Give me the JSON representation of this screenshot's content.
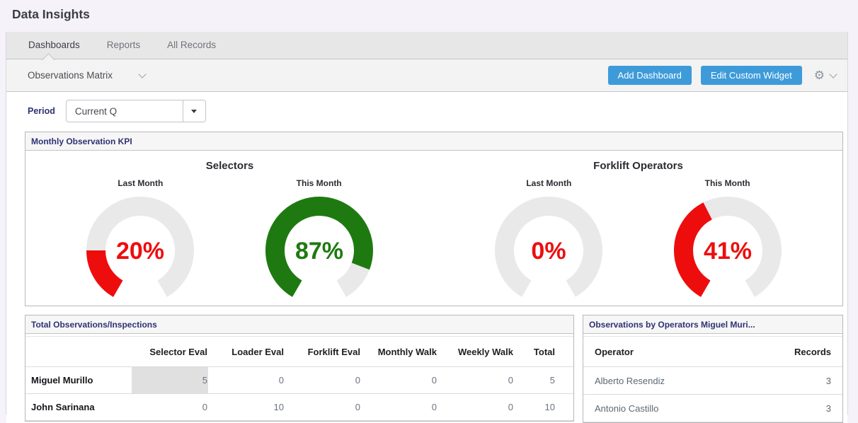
{
  "page": {
    "title": "Data Insights"
  },
  "tabs": [
    {
      "label": "Dashboards",
      "active": true
    },
    {
      "label": "Reports",
      "active": false
    },
    {
      "label": "All Records",
      "active": false
    }
  ],
  "toolbar": {
    "dashboard_selector": "Observations Matrix",
    "add_dashboard_label": "Add Dashboard",
    "edit_widget_label": "Edit Custom Widget"
  },
  "filters": {
    "period_label": "Period",
    "period_value": "Current Q"
  },
  "chart_data": {
    "type": "gauge",
    "panel_title": "Monthly Observation KPI",
    "geometry": {
      "start_deg": 210,
      "sweep_deg": 300,
      "track_color": "#e9e9e9"
    },
    "groups": [
      {
        "title": "Selectors",
        "gauges": [
          {
            "label": "Last Month",
            "value": 20,
            "unit": "%",
            "color": "#ee0d0d"
          },
          {
            "label": "This Month",
            "value": 87,
            "unit": "%",
            "color": "#1e7a10"
          }
        ]
      },
      {
        "title": "Forklift Operators",
        "gauges": [
          {
            "label": "Last Month",
            "value": 0,
            "unit": "%",
            "color": "#ee0d0d"
          },
          {
            "label": "This Month",
            "value": 41,
            "unit": "%",
            "color": "#ee0d0d"
          }
        ]
      }
    ]
  },
  "observations_table": {
    "title": "Total Observations/Inspections",
    "columns": [
      "",
      "Selector Eval",
      "Loader Eval",
      "Forklift Eval",
      "Monthly Walk",
      "Weekly Walk",
      "Total"
    ],
    "rows": [
      {
        "name": "Miguel Murillo",
        "values": [
          "5",
          "0",
          "0",
          "0",
          "0",
          "5"
        ]
      },
      {
        "name": "John Sarinana",
        "values": [
          "0",
          "10",
          "0",
          "0",
          "0",
          "10"
        ]
      }
    ],
    "highlight": {
      "row_index": 0,
      "col_index": 0
    }
  },
  "operators_table": {
    "title": "Observations by Operators Miguel Muri...",
    "columns": [
      "Operator",
      "Records"
    ],
    "rows": [
      {
        "name": "Alberto Resendiz",
        "records": "3"
      },
      {
        "name": "Antonio Castillo",
        "records": "3"
      }
    ]
  },
  "colors": {
    "accent_blue": "#3e9bd9",
    "title_navy": "#2e3274",
    "gauge_red": "#ee0d0d",
    "gauge_green": "#1e7a10",
    "gauge_track": "#e9e9e9"
  }
}
